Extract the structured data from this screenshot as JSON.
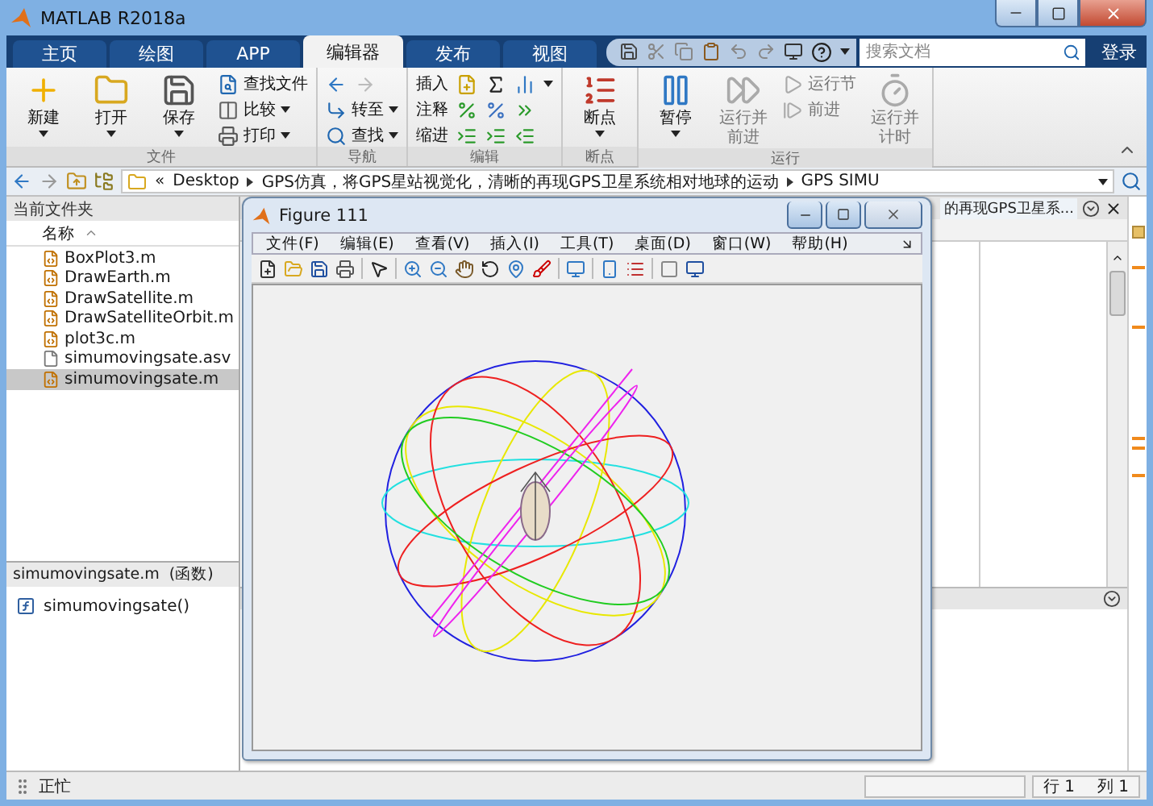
{
  "window": {
    "title": "MATLAB R2018a"
  },
  "tabs": [
    {
      "label": "主页",
      "selected": false
    },
    {
      "label": "绘图",
      "selected": false
    },
    {
      "label": "APP",
      "selected": false
    },
    {
      "label": "编辑器",
      "selected": true
    },
    {
      "label": "发布",
      "selected": false
    },
    {
      "label": "视图",
      "selected": false
    }
  ],
  "search": {
    "placeholder": "搜索文档"
  },
  "login": "登录",
  "toolstrip": [
    {
      "label": "文件",
      "items": [
        {
          "kind": "large",
          "label": "新建",
          "dropdown": true,
          "disabled": false
        },
        {
          "kind": "large",
          "label": "打开",
          "dropdown": true,
          "disabled": false
        },
        {
          "kind": "large",
          "label": "保存",
          "dropdown": true,
          "disabled": false
        },
        {
          "kind": "stack",
          "rows": [
            {
              "label": "查找文件",
              "dropdown": false,
              "disabled": false
            },
            {
              "label": "比较",
              "dropdown": true,
              "disabled": false
            },
            {
              "label": "打印",
              "dropdown": true,
              "disabled": false
            }
          ]
        }
      ]
    },
    {
      "label": "导航",
      "items": [
        {
          "kind": "stack",
          "rows": [
            {
              "kind": "arrows"
            },
            {
              "label": "转至",
              "dropdown": true,
              "disabled": false
            },
            {
              "label": "查找",
              "dropdown": true,
              "disabled": false
            }
          ]
        }
      ]
    },
    {
      "label": "编辑",
      "items": [
        {
          "kind": "stack",
          "rows": [
            {
              "label": "插入",
              "dropdown": true,
              "disabled": false,
              "kind": "tools"
            },
            {
              "label": "注释",
              "dropdown": false,
              "disabled": false,
              "kind": "tools"
            },
            {
              "label": "缩进",
              "dropdown": false,
              "disabled": false,
              "kind": "tools"
            }
          ]
        }
      ]
    },
    {
      "label": "断点",
      "items": [
        {
          "kind": "large",
          "label": "断点",
          "dropdown": true,
          "disabled": false
        }
      ]
    },
    {
      "label": "运行",
      "items": [
        {
          "kind": "large",
          "label": "暂停",
          "dropdown": true,
          "disabled": false
        },
        {
          "kind": "large",
          "label": "运行并前进",
          "dropdown": false,
          "disabled": true
        },
        {
          "kind": "stack",
          "rows": [
            {
              "label": "运行节",
              "dropdown": false,
              "disabled": true
            },
            {
              "label": "前进",
              "dropdown": false,
              "disabled": true
            }
          ]
        },
        {
          "kind": "large",
          "label": "运行并计时",
          "dropdown": false,
          "disabled": true
        }
      ]
    }
  ],
  "path_bar": {
    "overflow": "«",
    "segments": [
      "Desktop",
      "GPS仿真，将GPS星站视觉化，清晰的再现GPS卫星系统相对地球的运动",
      "GPS SIMU"
    ]
  },
  "current_folder": {
    "title": "当前文件夹",
    "column": "名称",
    "files": [
      {
        "name": "BoxPlot3.m",
        "kind": "script",
        "selected": false
      },
      {
        "name": "DrawEarth.m",
        "kind": "script",
        "selected": false
      },
      {
        "name": "DrawSatellite.m",
        "kind": "script",
        "selected": false
      },
      {
        "name": "DrawSatelliteOrbit.m",
        "kind": "script",
        "selected": false
      },
      {
        "name": "plot3c.m",
        "kind": "script",
        "selected": false
      },
      {
        "name": "simumovingsate.asv",
        "kind": "plain",
        "selected": false
      },
      {
        "name": "simumovingsate.m",
        "kind": "script",
        "selected": true
      }
    ],
    "details": {
      "name": "simumovingsate.m",
      "type": "(函数)",
      "functions": [
        "simumovingsate()"
      ]
    }
  },
  "editor": {
    "tab": "的再现GPS卫星系..."
  },
  "figure": {
    "title": "Figure 111",
    "menus": [
      "文件(F)",
      "编辑(E)",
      "查看(V)",
      "插入(I)",
      "工具(T)",
      "桌面(D)",
      "窗口(W)",
      "帮助(H)"
    ]
  },
  "status_bar": {
    "status": "正忙",
    "line": "行  1",
    "column": "列  1"
  }
}
